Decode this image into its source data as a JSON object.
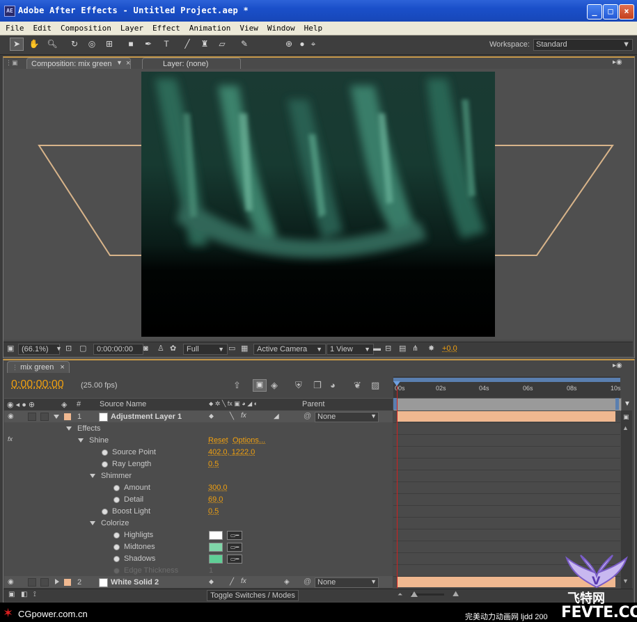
{
  "app": {
    "icon_label": "AE",
    "title": "Adobe After Effects - Untitled Project.aep *",
    "window_buttons": [
      "_",
      "□",
      "×"
    ]
  },
  "menu": [
    "File",
    "Edit",
    "Composition",
    "Layer",
    "Effect",
    "Animation",
    "View",
    "Window",
    "Help"
  ],
  "toolbar": {
    "workspace_label": "Workspace:",
    "workspace_value": "Standard"
  },
  "comp_panel": {
    "tab_comp": "Composition: mix green",
    "tab_layer": "Layer: (none)",
    "footer": {
      "zoom": "(66.1%)",
      "timecode": "0:00:00:00",
      "resolution": "Full",
      "camera": "Active Camera",
      "views": "1 View",
      "exposure": "+0.0"
    }
  },
  "timeline": {
    "tab": "mix green",
    "timecode": "0:00:00:00",
    "fps": "(25.00 fps)",
    "headers": {
      "num": "#",
      "source": "Source Name",
      "parent": "Parent"
    },
    "ruler_ticks": [
      "00s",
      "02s",
      "04s",
      "06s",
      "08s",
      "10s"
    ],
    "layers": [
      {
        "index": "1",
        "name": "Adjustment Layer 1",
        "parent": "None",
        "label_color": "#f0b890"
      },
      {
        "index": "2",
        "name": "White Solid 2",
        "parent": "None",
        "label_color": "#f0b890"
      }
    ],
    "properties": {
      "effects": "Effects",
      "shine": "Shine",
      "reset": "Reset",
      "options": "Options...",
      "source_point_label": "Source Point",
      "source_point_value": "402.0, 1222.0",
      "ray_length_label": "Ray Length",
      "ray_length_value": "0.5",
      "shimmer": "Shimmer",
      "amount_label": "Amount",
      "amount_value": "300.0",
      "detail_label": "Detail",
      "detail_value": "69.0",
      "boost_light_label": "Boost Light",
      "boost_light_value": "0.5",
      "colorize": "Colorize",
      "highlights_label": "Highligts",
      "highlights_color": "#ffffff",
      "midtones_label": "Midtones",
      "midtones_color": "#7fd6a8",
      "shadows_label": "Shadows",
      "shadows_color": "#5fcf96",
      "edge_thickness_label": "Edge Thickness",
      "edge_thickness_value": "1"
    },
    "toggle_button": "Toggle Switches / Modes"
  },
  "watermark": {
    "left_text": "CGpower.com.cn",
    "right_text": "完美动力动画网 ljdd 200",
    "brand_cn": "飞特网",
    "brand_en": "FEVTE.COM"
  },
  "colors": {
    "accent_orange": "#f0a010",
    "panel_border": "#c89a4a",
    "layer_bar": "#f0b890"
  }
}
